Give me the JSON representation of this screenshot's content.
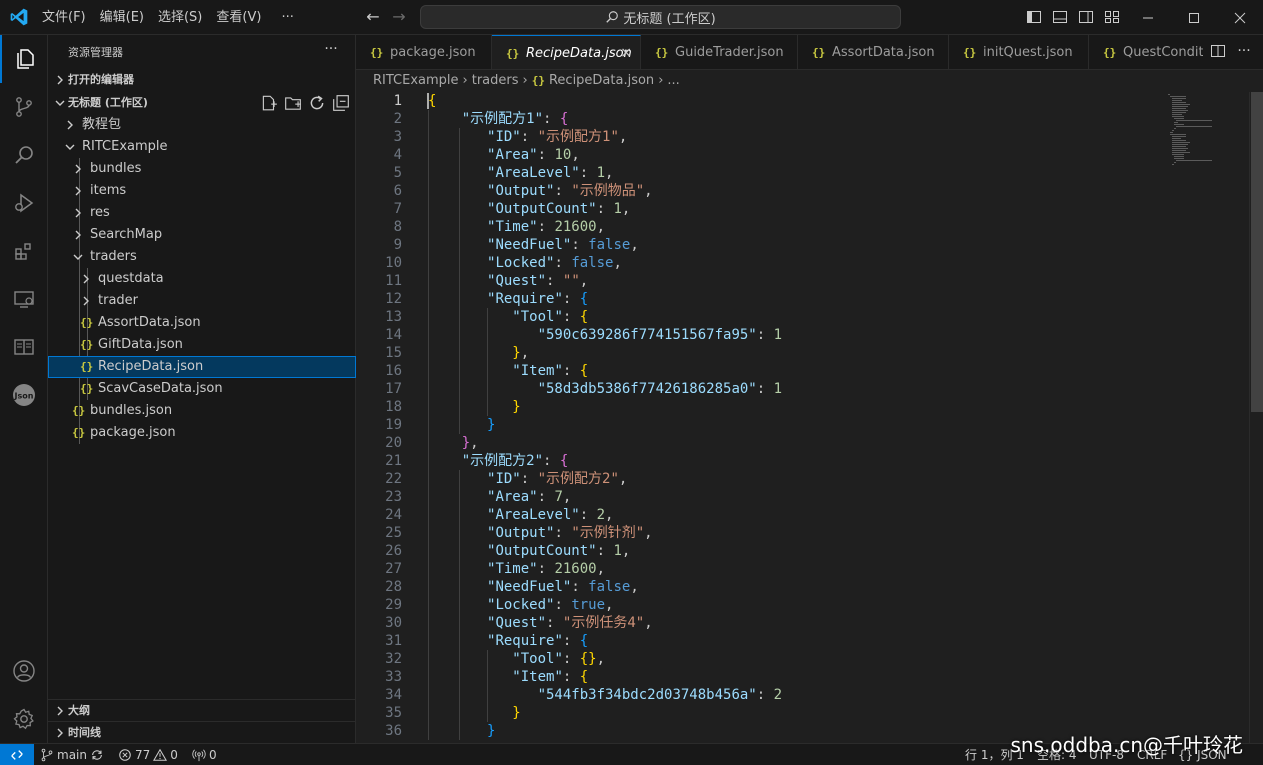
{
  "titlebar": {
    "menus": [
      "文件(F)",
      "编辑(E)",
      "选择(S)",
      "查看(V)",
      "···"
    ],
    "search_text": "无标题 (工作区)",
    "back_label": "←",
    "forward_label": "→"
  },
  "sidebar": {
    "title": "资源管理器",
    "more_label": "···",
    "open_editors_label": "打开的编辑器",
    "workspace_label": "无标题 (工作区)",
    "tree": [
      {
        "name": "教程包",
        "kind": "folder",
        "expanded": false,
        "depth": 1
      },
      {
        "name": "RITCExample",
        "kind": "folder",
        "expanded": true,
        "depth": 1
      },
      {
        "name": "bundles",
        "kind": "folder",
        "expanded": false,
        "depth": 2
      },
      {
        "name": "items",
        "kind": "folder",
        "expanded": false,
        "depth": 2
      },
      {
        "name": "res",
        "kind": "folder",
        "expanded": false,
        "depth": 2
      },
      {
        "name": "SearchMap",
        "kind": "folder",
        "expanded": false,
        "depth": 2
      },
      {
        "name": "traders",
        "kind": "folder",
        "expanded": true,
        "depth": 2
      },
      {
        "name": "questdata",
        "kind": "folder",
        "expanded": false,
        "depth": 3
      },
      {
        "name": "trader",
        "kind": "folder",
        "expanded": false,
        "depth": 3
      },
      {
        "name": "AssortData.json",
        "kind": "json",
        "depth": 3
      },
      {
        "name": "GiftData.json",
        "kind": "json",
        "depth": 3
      },
      {
        "name": "RecipeData.json",
        "kind": "json",
        "depth": 3,
        "selected": true
      },
      {
        "name": "ScavCaseData.json",
        "kind": "json",
        "depth": 3
      },
      {
        "name": "bundles.json",
        "kind": "json",
        "depth": 2
      },
      {
        "name": "package.json",
        "kind": "json",
        "depth": 2
      }
    ],
    "outline_label": "大纲",
    "timeline_label": "时间线"
  },
  "tabs": [
    {
      "label": "package.json",
      "active": false
    },
    {
      "label": "RecipeData.json",
      "active": true
    },
    {
      "label": "GuideTrader.json",
      "active": false
    },
    {
      "label": "AssortData.json",
      "active": false
    },
    {
      "label": "initQuest.json",
      "active": false
    },
    {
      "label": "QuestConditio",
      "active": false
    }
  ],
  "tab_icon": "{}",
  "tab_close": "×",
  "breadcrumb": {
    "parts": [
      "RITCExample",
      "traders",
      "RecipeData.json",
      "..."
    ],
    "sep": "›"
  },
  "editor": {
    "lines": [
      [
        [
          "br1",
          "{"
        ]
      ],
      [
        [
          "p",
          "    "
        ],
        [
          "k",
          "\"示例配方1\""
        ],
        [
          "p",
          ": "
        ],
        [
          "br2",
          "{"
        ]
      ],
      [
        [
          "p",
          "       "
        ],
        [
          "k",
          "\"ID\""
        ],
        [
          "p",
          ": "
        ],
        [
          "s",
          "\"示例配方1\""
        ],
        [
          "p",
          ","
        ]
      ],
      [
        [
          "p",
          "       "
        ],
        [
          "k",
          "\"Area\""
        ],
        [
          "p",
          ": "
        ],
        [
          "n",
          "10"
        ],
        [
          "p",
          ","
        ]
      ],
      [
        [
          "p",
          "       "
        ],
        [
          "k",
          "\"AreaLevel\""
        ],
        [
          "p",
          ": "
        ],
        [
          "n",
          "1"
        ],
        [
          "p",
          ","
        ]
      ],
      [
        [
          "p",
          "       "
        ],
        [
          "k",
          "\"Output\""
        ],
        [
          "p",
          ": "
        ],
        [
          "s",
          "\"示例物品\""
        ],
        [
          "p",
          ","
        ]
      ],
      [
        [
          "p",
          "       "
        ],
        [
          "k",
          "\"OutputCount\""
        ],
        [
          "p",
          ": "
        ],
        [
          "n",
          "1"
        ],
        [
          "p",
          ","
        ]
      ],
      [
        [
          "p",
          "       "
        ],
        [
          "k",
          "\"Time\""
        ],
        [
          "p",
          ": "
        ],
        [
          "n",
          "21600"
        ],
        [
          "p",
          ","
        ]
      ],
      [
        [
          "p",
          "       "
        ],
        [
          "k",
          "\"NeedFuel\""
        ],
        [
          "p",
          ": "
        ],
        [
          "b",
          "false"
        ],
        [
          "p",
          ","
        ]
      ],
      [
        [
          "p",
          "       "
        ],
        [
          "k",
          "\"Locked\""
        ],
        [
          "p",
          ": "
        ],
        [
          "b",
          "false"
        ],
        [
          "p",
          ","
        ]
      ],
      [
        [
          "p",
          "       "
        ],
        [
          "k",
          "\"Quest\""
        ],
        [
          "p",
          ": "
        ],
        [
          "s",
          "\"\""
        ],
        [
          "p",
          ","
        ]
      ],
      [
        [
          "p",
          "       "
        ],
        [
          "k",
          "\"Require\""
        ],
        [
          "p",
          ": "
        ],
        [
          "br3",
          "{"
        ]
      ],
      [
        [
          "p",
          "          "
        ],
        [
          "k",
          "\"Tool\""
        ],
        [
          "p",
          ": "
        ],
        [
          "br1",
          "{"
        ]
      ],
      [
        [
          "p",
          "             "
        ],
        [
          "k",
          "\"590c639286f774151567fa95\""
        ],
        [
          "p",
          ": "
        ],
        [
          "n",
          "1"
        ]
      ],
      [
        [
          "p",
          "          "
        ],
        [
          "br1",
          "}"
        ],
        [
          "p",
          ","
        ]
      ],
      [
        [
          "p",
          "          "
        ],
        [
          "k",
          "\"Item\""
        ],
        [
          "p",
          ": "
        ],
        [
          "br1",
          "{"
        ]
      ],
      [
        [
          "p",
          "             "
        ],
        [
          "k",
          "\"58d3db5386f77426186285a0\""
        ],
        [
          "p",
          ": "
        ],
        [
          "n",
          "1"
        ]
      ],
      [
        [
          "p",
          "          "
        ],
        [
          "br1",
          "}"
        ]
      ],
      [
        [
          "p",
          "       "
        ],
        [
          "br3",
          "}"
        ]
      ],
      [
        [
          "p",
          "    "
        ],
        [
          "br2",
          "}"
        ],
        [
          "p",
          ","
        ]
      ],
      [
        [
          "p",
          "    "
        ],
        [
          "k",
          "\"示例配方2\""
        ],
        [
          "p",
          ": "
        ],
        [
          "br2",
          "{"
        ]
      ],
      [
        [
          "p",
          "       "
        ],
        [
          "k",
          "\"ID\""
        ],
        [
          "p",
          ": "
        ],
        [
          "s",
          "\"示例配方2\""
        ],
        [
          "p",
          ","
        ]
      ],
      [
        [
          "p",
          "       "
        ],
        [
          "k",
          "\"Area\""
        ],
        [
          "p",
          ": "
        ],
        [
          "n",
          "7"
        ],
        [
          "p",
          ","
        ]
      ],
      [
        [
          "p",
          "       "
        ],
        [
          "k",
          "\"AreaLevel\""
        ],
        [
          "p",
          ": "
        ],
        [
          "n",
          "2"
        ],
        [
          "p",
          ","
        ]
      ],
      [
        [
          "p",
          "       "
        ],
        [
          "k",
          "\"Output\""
        ],
        [
          "p",
          ": "
        ],
        [
          "s",
          "\"示例针剂\""
        ],
        [
          "p",
          ","
        ]
      ],
      [
        [
          "p",
          "       "
        ],
        [
          "k",
          "\"OutputCount\""
        ],
        [
          "p",
          ": "
        ],
        [
          "n",
          "1"
        ],
        [
          "p",
          ","
        ]
      ],
      [
        [
          "p",
          "       "
        ],
        [
          "k",
          "\"Time\""
        ],
        [
          "p",
          ": "
        ],
        [
          "n",
          "21600"
        ],
        [
          "p",
          ","
        ]
      ],
      [
        [
          "p",
          "       "
        ],
        [
          "k",
          "\"NeedFuel\""
        ],
        [
          "p",
          ": "
        ],
        [
          "b",
          "false"
        ],
        [
          "p",
          ","
        ]
      ],
      [
        [
          "p",
          "       "
        ],
        [
          "k",
          "\"Locked\""
        ],
        [
          "p",
          ": "
        ],
        [
          "b",
          "true"
        ],
        [
          "p",
          ","
        ]
      ],
      [
        [
          "p",
          "       "
        ],
        [
          "k",
          "\"Quest\""
        ],
        [
          "p",
          ": "
        ],
        [
          "s",
          "\"示例任务4\""
        ],
        [
          "p",
          ","
        ]
      ],
      [
        [
          "p",
          "       "
        ],
        [
          "k",
          "\"Require\""
        ],
        [
          "p",
          ": "
        ],
        [
          "br3",
          "{"
        ]
      ],
      [
        [
          "p",
          "          "
        ],
        [
          "k",
          "\"Tool\""
        ],
        [
          "p",
          ": "
        ],
        [
          "br1",
          "{}"
        ],
        [
          "p",
          ","
        ]
      ],
      [
        [
          "p",
          "          "
        ],
        [
          "k",
          "\"Item\""
        ],
        [
          "p",
          ": "
        ],
        [
          "br1",
          "{"
        ]
      ],
      [
        [
          "p",
          "             "
        ],
        [
          "k",
          "\"544fb3f34bdc2d03748b456a\""
        ],
        [
          "p",
          ": "
        ],
        [
          "n",
          "2"
        ]
      ],
      [
        [
          "p",
          "          "
        ],
        [
          "br1",
          "}"
        ]
      ],
      [
        [
          "p",
          "       "
        ],
        [
          "br3",
          "}"
        ]
      ]
    ]
  },
  "statusbar": {
    "branch": "main",
    "errors": "77",
    "warnings": "0",
    "ports": "0",
    "position": "行 1，列 1",
    "spaces": "空格: 4",
    "encoding": "UTF-8",
    "eol": "CRLF",
    "language": "{} JSON"
  },
  "watermark": "sns.oddba.cn@千叶玲花",
  "colors": {
    "accent": "#0078d4",
    "selection": "#04395e",
    "json_icon": "#cbcb41"
  }
}
